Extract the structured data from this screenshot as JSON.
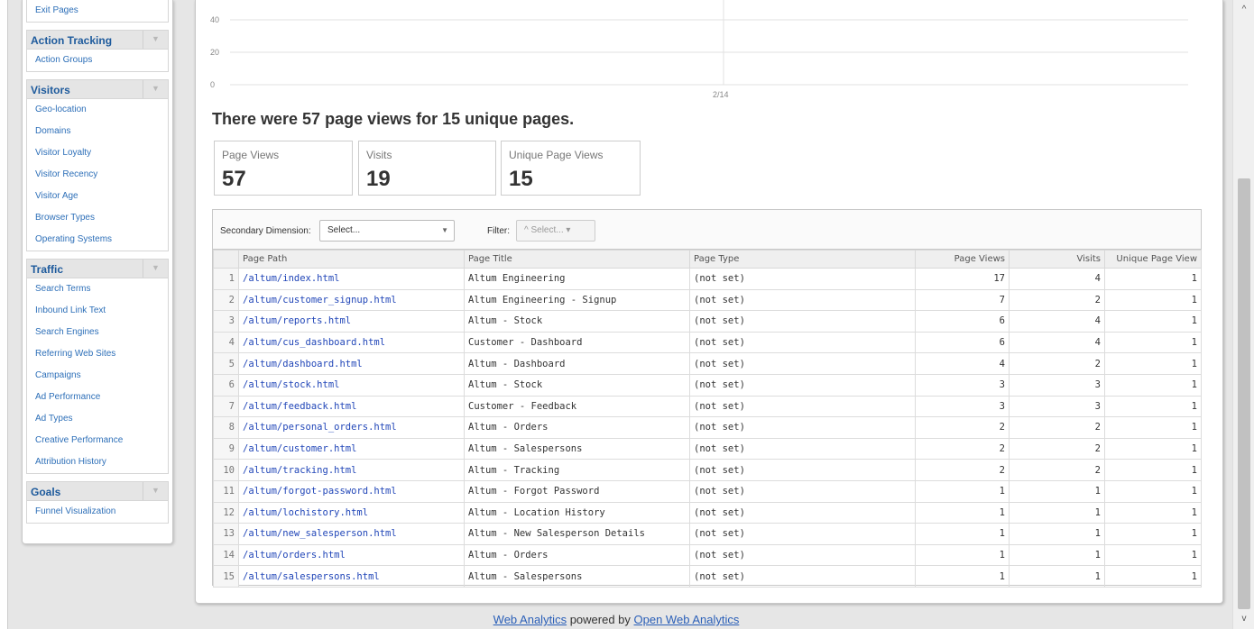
{
  "sidebar": {
    "groups": [
      {
        "title": "",
        "items": [
          "Exit Pages"
        ]
      },
      {
        "title": "Action Tracking",
        "items": [
          "Action Groups"
        ]
      },
      {
        "title": "Visitors",
        "items": [
          "Geo-location",
          "Domains",
          "Visitor Loyalty",
          "Visitor Recency",
          "Visitor Age",
          "Browser Types",
          "Operating Systems"
        ]
      },
      {
        "title": "Traffic",
        "items": [
          "Search Terms",
          "Inbound Link Text",
          "Search Engines",
          "Referring Web Sites",
          "Campaigns",
          "Ad Performance",
          "Ad Types",
          "Creative Performance",
          "Attribution History"
        ]
      },
      {
        "title": "Goals",
        "items": [
          "Funnel Visualization"
        ]
      }
    ]
  },
  "chart_data": {
    "type": "line",
    "y_ticks": [
      "40",
      "20",
      "0"
    ],
    "x_ticks": [
      "2/14"
    ],
    "ylim": [
      0,
      40
    ]
  },
  "headline": "There were 57 page views for 15 unique pages.",
  "kpis": [
    {
      "label": "Page Views",
      "value": "57"
    },
    {
      "label": "Visits",
      "value": "19"
    },
    {
      "label": "Unique Page Views",
      "value": "15"
    }
  ],
  "controls": {
    "secondary_label": "Secondary Dimension:",
    "secondary_value": "Select...",
    "filter_label": "Filter:",
    "filter_value": "^ Select... ▾"
  },
  "table": {
    "headers": [
      "",
      "Page Path",
      "Page Title",
      "Page Type",
      "Page Views",
      "Visits",
      "Unique Page View"
    ],
    "rows": [
      [
        "1",
        "/altum/index.html",
        "Altum Engineering",
        "(not set)",
        "17",
        "4",
        "1"
      ],
      [
        "2",
        "/altum/customer_signup.html",
        "Altum Engineering - Signup",
        "(not set)",
        "7",
        "2",
        "1"
      ],
      [
        "3",
        "/altum/reports.html",
        "Altum - Stock",
        "(not set)",
        "6",
        "4",
        "1"
      ],
      [
        "4",
        "/altum/cus_dashboard.html",
        "Customer - Dashboard",
        "(not set)",
        "6",
        "4",
        "1"
      ],
      [
        "5",
        "/altum/dashboard.html",
        "Altum - Dashboard",
        "(not set)",
        "4",
        "2",
        "1"
      ],
      [
        "6",
        "/altum/stock.html",
        "Altum - Stock",
        "(not set)",
        "3",
        "3",
        "1"
      ],
      [
        "7",
        "/altum/feedback.html",
        "Customer - Feedback",
        "(not set)",
        "3",
        "3",
        "1"
      ],
      [
        "8",
        "/altum/personal_orders.html",
        "Altum - Orders",
        "(not set)",
        "2",
        "2",
        "1"
      ],
      [
        "9",
        "/altum/customer.html",
        "Altum - Salespersons",
        "(not set)",
        "2",
        "2",
        "1"
      ],
      [
        "10",
        "/altum/tracking.html",
        "Altum - Tracking",
        "(not set)",
        "2",
        "2",
        "1"
      ],
      [
        "11",
        "/altum/forgot-password.html",
        "Altum - Forgot Password",
        "(not set)",
        "1",
        "1",
        "1"
      ],
      [
        "12",
        "/altum/lochistory.html",
        "Altum - Location History",
        "(not set)",
        "1",
        "1",
        "1"
      ],
      [
        "13",
        "/altum/new_salesperson.html",
        "Altum - New Salesperson Details",
        "(not set)",
        "1",
        "1",
        "1"
      ],
      [
        "14",
        "/altum/orders.html",
        "Altum - Orders",
        "(not set)",
        "1",
        "1",
        "1"
      ],
      [
        "15",
        "/altum/salespersons.html",
        "Altum - Salespersons",
        "(not set)",
        "1",
        "1",
        "1"
      ]
    ]
  },
  "footer": {
    "link1": "Web Analytics",
    "middle": " powered by ",
    "link2": "Open Web Analytics"
  },
  "scroll": {
    "up": "^",
    "down": "v"
  },
  "icons": {
    "toggle": "triangle-down-icon",
    "caret": "caret-down-icon"
  },
  "colors": {
    "link": "#2146b8",
    "group_title": "#1d5a9c"
  }
}
